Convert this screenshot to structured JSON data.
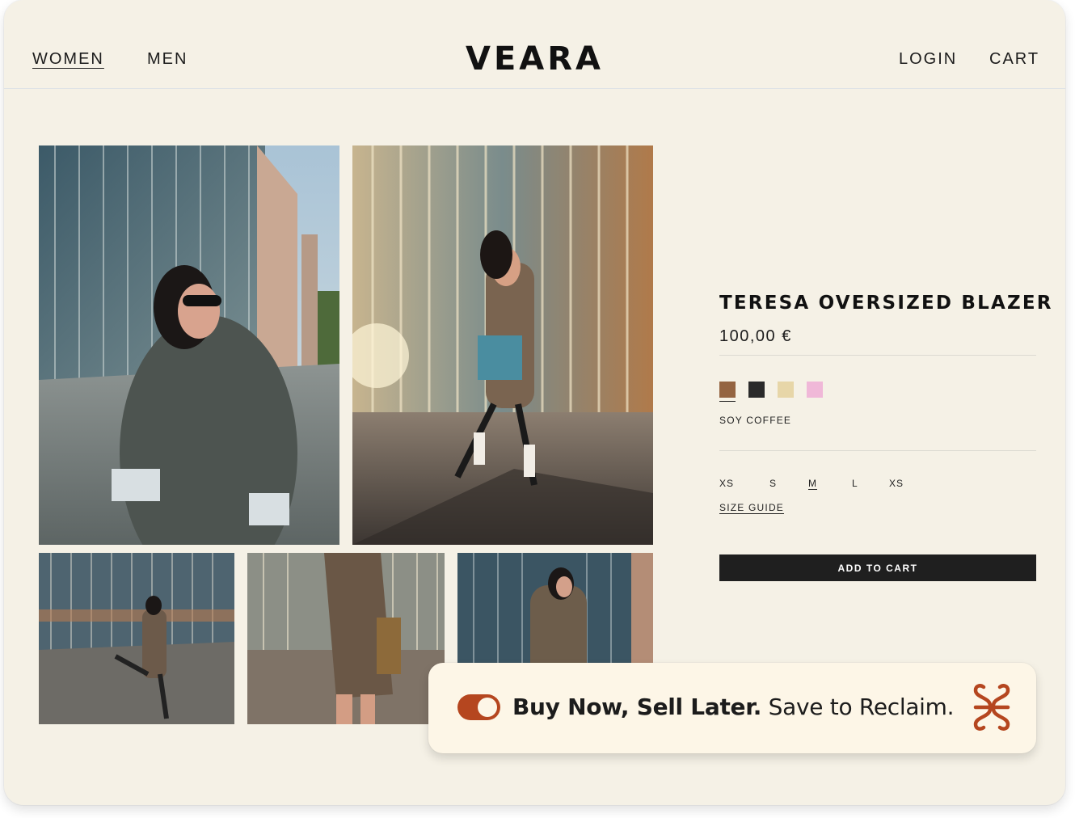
{
  "nav": {
    "women": "WOMEN",
    "men": "MEN",
    "logo": "VEARA",
    "login": "LOGIN",
    "cart": "CART"
  },
  "product": {
    "title": "TERESA OVERSIZED BLAZER",
    "price": "100,00 €",
    "colors": [
      {
        "name": "soy-coffee",
        "hex": "#946441",
        "selected": true
      },
      {
        "name": "black",
        "hex": "#2a2a2a",
        "selected": false
      },
      {
        "name": "cream",
        "hex": "#e7d6a8",
        "selected": false
      },
      {
        "name": "pink",
        "hex": "#f0b8d8",
        "selected": false
      }
    ],
    "selected_color_name": "SOY COFFEE",
    "sizes": [
      "XS",
      "S",
      "M",
      "L",
      "XS"
    ],
    "selected_size_index": 2,
    "size_guide": "SIZE GUIDE",
    "add_to_cart": "ADD TO CART"
  },
  "banner": {
    "bold_text": "Buy Now, Sell Later.",
    "text": " Save to Reclaim.",
    "toggle_on": true,
    "accent": "#b5461f"
  },
  "icons": {
    "banner_logo": "reclaim-logo-icon"
  }
}
